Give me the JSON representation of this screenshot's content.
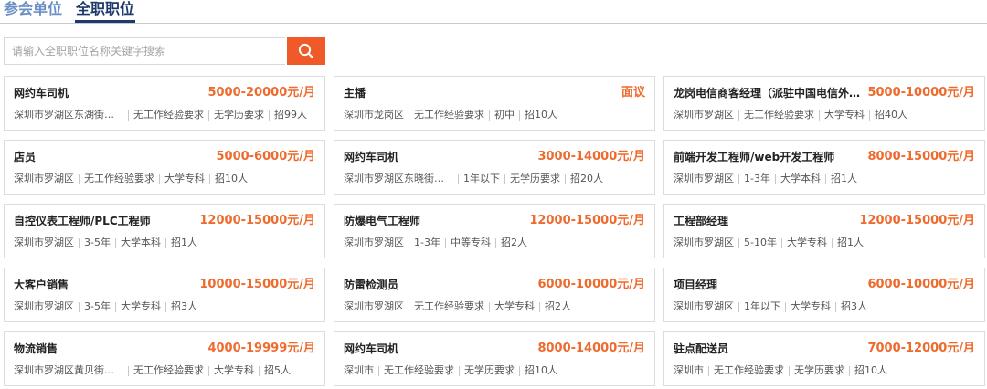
{
  "tabs": [
    {
      "label": "参会单位",
      "active": false
    },
    {
      "label": "全职职位",
      "active": true
    }
  ],
  "search": {
    "placeholder": "请输入全职职位名称关键字搜索",
    "value": "",
    "icon": "search-icon"
  },
  "colors": {
    "accent": "#f05a28",
    "salary": "#ee6a2d",
    "tab_active": "#1d3a6a",
    "tab_inactive": "#6b8fc4"
  },
  "jobs": [
    {
      "title": "网约车司机",
      "salary": "5000-20000元/月",
      "location": "深圳市罗湖区东湖街道...",
      "experience": "无工作经验要求",
      "education": "无学历要求",
      "headcount": "招99人"
    },
    {
      "title": "主播",
      "salary": "面议",
      "location": "深圳市龙岗区",
      "experience": "无工作经验要求",
      "education": "初中",
      "headcount": "招10人"
    },
    {
      "title": "龙岗电信商客经理（派驻中国电信外...",
      "salary": "5000-10000元/月",
      "location": "深圳市罗湖区",
      "experience": "无工作经验要求",
      "education": "大学专科",
      "headcount": "招40人"
    },
    {
      "title": "店员",
      "salary": "5000-6000元/月",
      "location": "深圳市罗湖区",
      "experience": "无工作经验要求",
      "education": "大学专科",
      "headcount": "招10人"
    },
    {
      "title": "网约车司机",
      "salary": "3000-14000元/月",
      "location": "深圳市罗湖区东晓街道...",
      "experience": "1年以下",
      "education": "无学历要求",
      "headcount": "招20人"
    },
    {
      "title": "前端开发工程师/web开发工程师",
      "salary": "8000-15000元/月",
      "location": "深圳市罗湖区",
      "experience": "1-3年",
      "education": "大学本科",
      "headcount": "招1人"
    },
    {
      "title": "自控仪表工程师/PLC工程师",
      "salary": "12000-15000元/月",
      "location": "深圳市罗湖区",
      "experience": "3-5年",
      "education": "大学本科",
      "headcount": "招1人"
    },
    {
      "title": "防爆电气工程师",
      "salary": "12000-15000元/月",
      "location": "深圳市罗湖区",
      "experience": "1-3年",
      "education": "中等专科",
      "headcount": "招2人"
    },
    {
      "title": "工程部经理",
      "salary": "12000-15000元/月",
      "location": "深圳市罗湖区",
      "experience": "5-10年",
      "education": "大学专科",
      "headcount": "招1人"
    },
    {
      "title": "大客户销售",
      "salary": "10000-15000元/月",
      "location": "深圳市罗湖区",
      "experience": "3-5年",
      "education": "大学专科",
      "headcount": "招3人"
    },
    {
      "title": "防雷检测员",
      "salary": "6000-10000元/月",
      "location": "深圳市罗湖区",
      "experience": "无工作经验要求",
      "education": "大学专科",
      "headcount": "招2人"
    },
    {
      "title": "项目经理",
      "salary": "6000-10000元/月",
      "location": "深圳市罗湖区",
      "experience": "1年以下",
      "education": "大学专科",
      "headcount": "招3人"
    },
    {
      "title": "物流销售",
      "salary": "4000-19999元/月",
      "location": "深圳市罗湖区黄贝街道...",
      "experience": "无工作经验要求",
      "education": "大学专科",
      "headcount": "招5人"
    },
    {
      "title": "网约车司机",
      "salary": "8000-14000元/月",
      "location": "深圳市",
      "experience": "无工作经验要求",
      "education": "无学历要求",
      "headcount": "招10人"
    },
    {
      "title": "驻点配送员",
      "salary": "7000-12000元/月",
      "location": "深圳市",
      "experience": "无工作经验要求",
      "education": "无学历要求",
      "headcount": "招10人"
    }
  ]
}
